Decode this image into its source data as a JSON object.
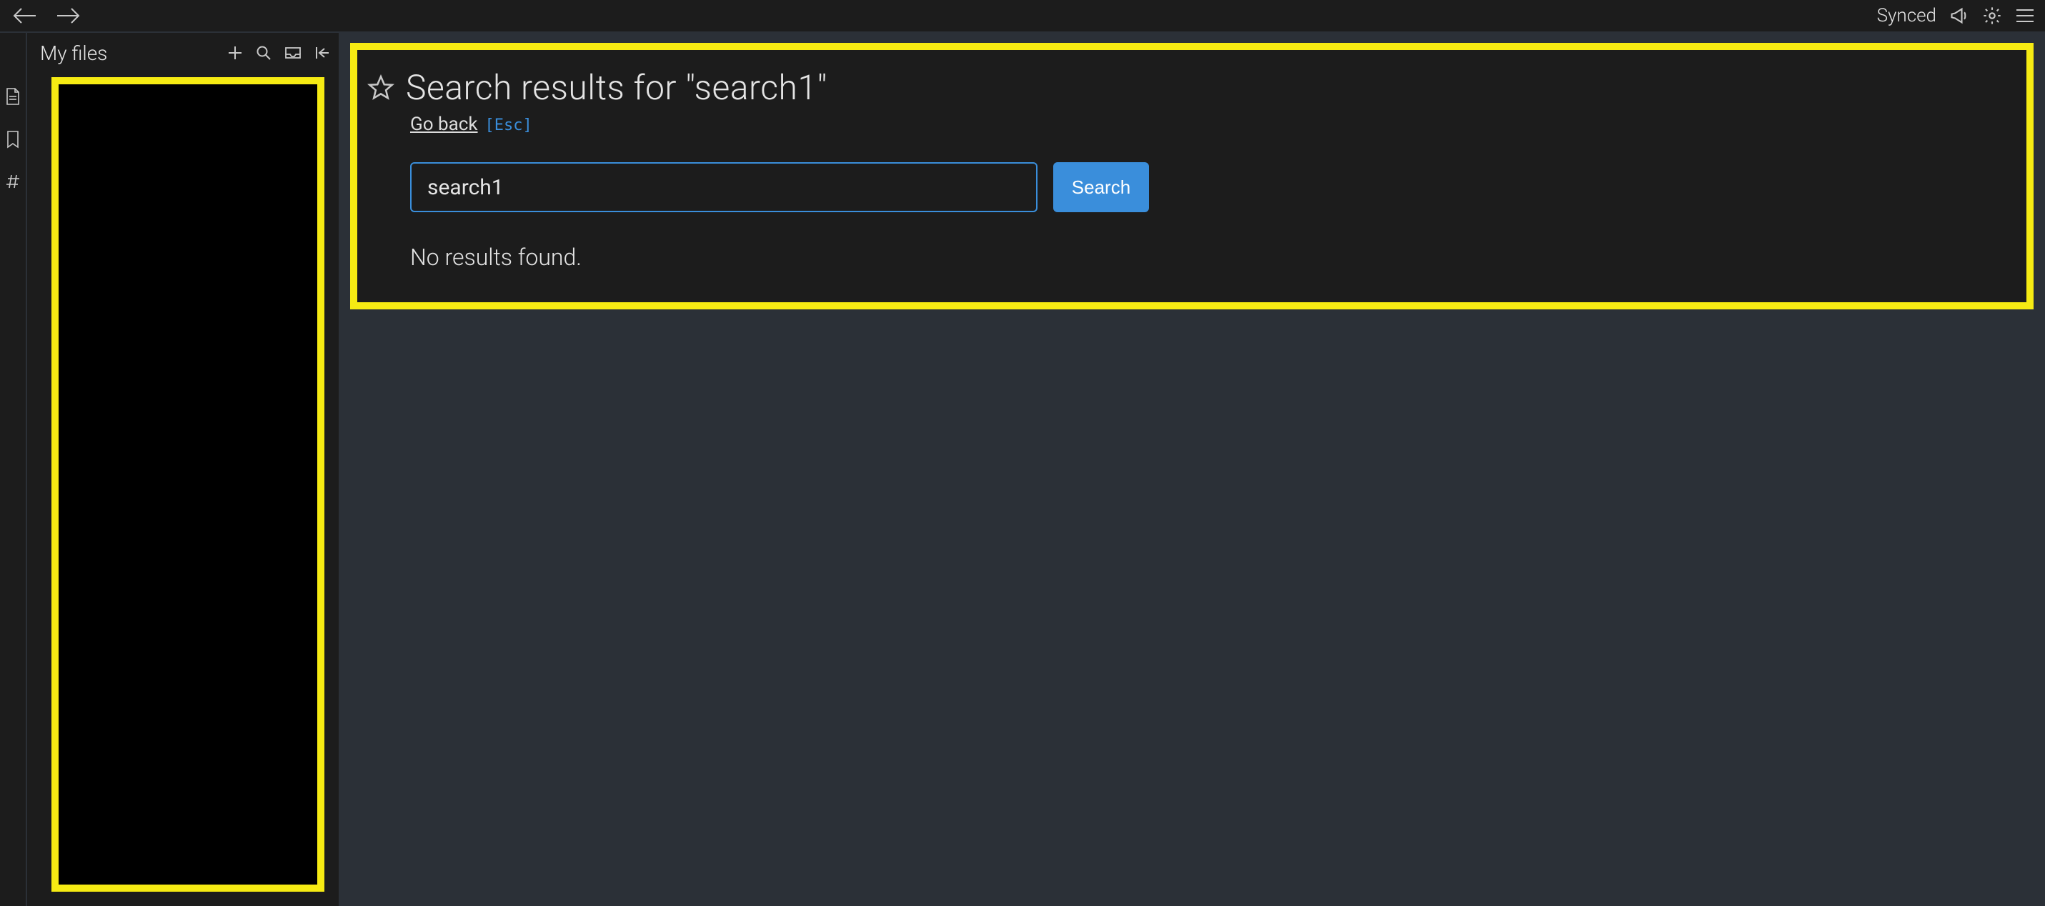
{
  "topbar": {
    "sync_status": "Synced"
  },
  "sidebar": {
    "title": "My files"
  },
  "main": {
    "title": "Search results for \"search1\"",
    "go_back": "Go back",
    "esc_hint": "[Esc]",
    "search_value": "search1",
    "search_button": "Search",
    "no_results": "No results found."
  }
}
